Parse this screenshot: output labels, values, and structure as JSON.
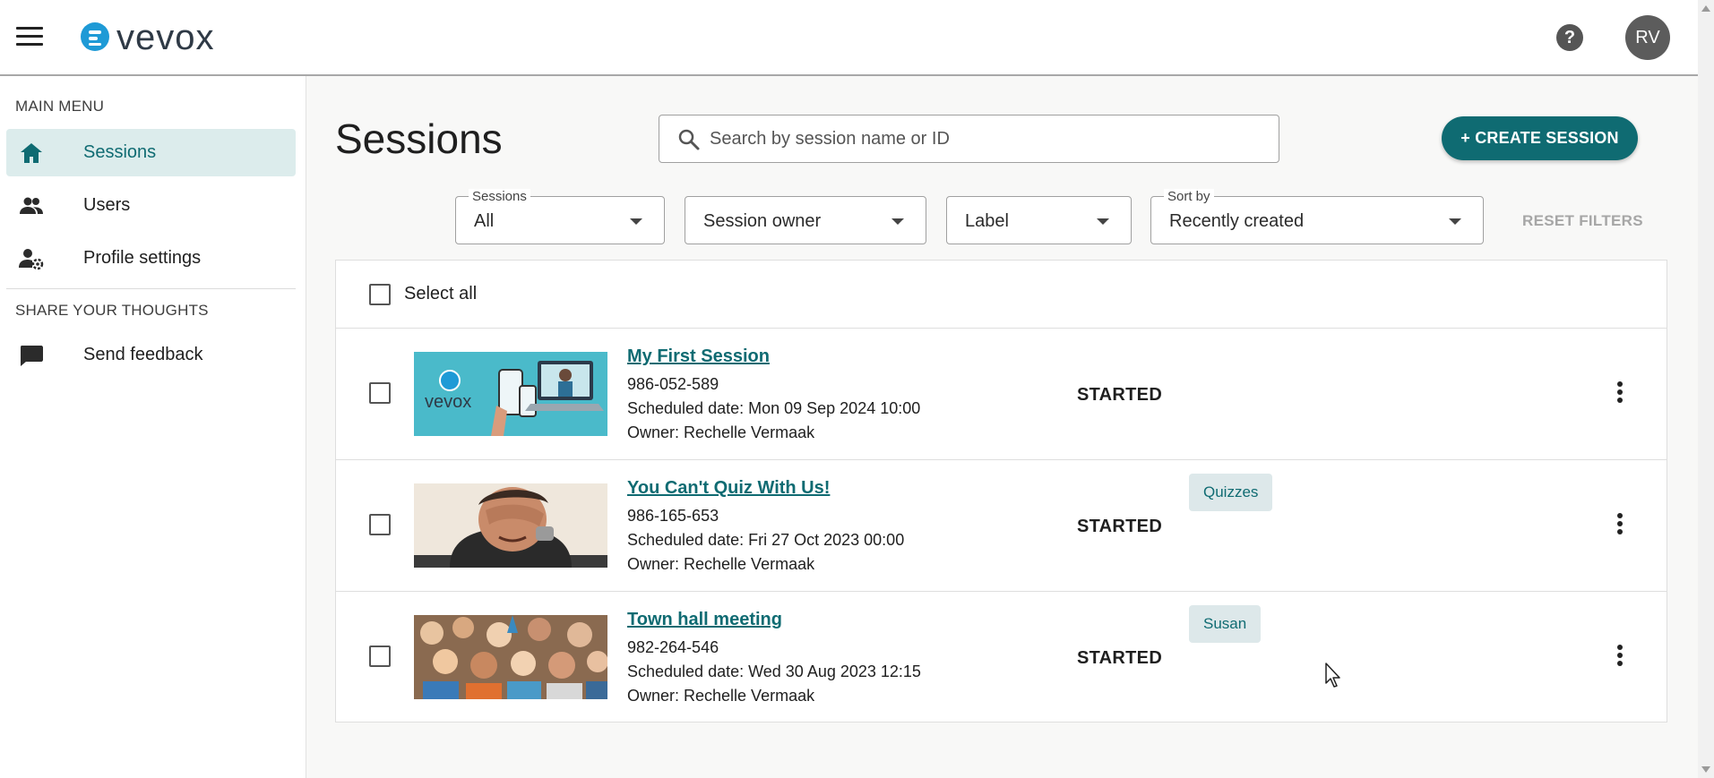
{
  "app": {
    "logo_text": "vevox",
    "avatar_initials": "RV",
    "help_symbol": "?",
    "brand_color": "#0f6b72"
  },
  "sidebar": {
    "main_menu_title": "MAIN MENU",
    "items": [
      {
        "label": "Sessions",
        "icon": "home-icon",
        "active": true
      },
      {
        "label": "Users",
        "icon": "users-icon",
        "active": false
      },
      {
        "label": "Profile settings",
        "icon": "profile-settings-icon",
        "active": false
      }
    ],
    "share_title": "SHARE YOUR THOUGHTS",
    "feedback_label": "Send feedback"
  },
  "main": {
    "title": "Sessions",
    "search_placeholder": "Search by session name or ID",
    "create_button": "+ CREATE SESSION",
    "filters": {
      "sessions": {
        "legend": "Sessions",
        "value": "All"
      },
      "owner": {
        "value": "Session owner"
      },
      "label": {
        "value": "Label"
      },
      "sort": {
        "legend": "Sort by",
        "value": "Recently created"
      }
    },
    "reset_filters": "RESET FILTERS",
    "select_all": "Select all"
  },
  "sessions": [
    {
      "title": "My First Session",
      "id": "986-052-589",
      "scheduled": "Scheduled date: Mon 09 Sep 2024 10:00",
      "owner": "Owner: Rechelle Vermaak",
      "status": "STARTED",
      "label": ""
    },
    {
      "title": "You Can't Quiz With Us!",
      "id": "986-165-653",
      "scheduled": "Scheduled date: Fri 27 Oct 2023 00:00",
      "owner": "Owner: Rechelle Vermaak",
      "status": "STARTED",
      "label": "Quizzes"
    },
    {
      "title": "Town hall meeting",
      "id": "982-264-546",
      "scheduled": "Scheduled date: Wed 30 Aug 2023 12:15",
      "owner": "Owner: Rechelle Vermaak",
      "status": "STARTED",
      "label": "Susan"
    }
  ]
}
